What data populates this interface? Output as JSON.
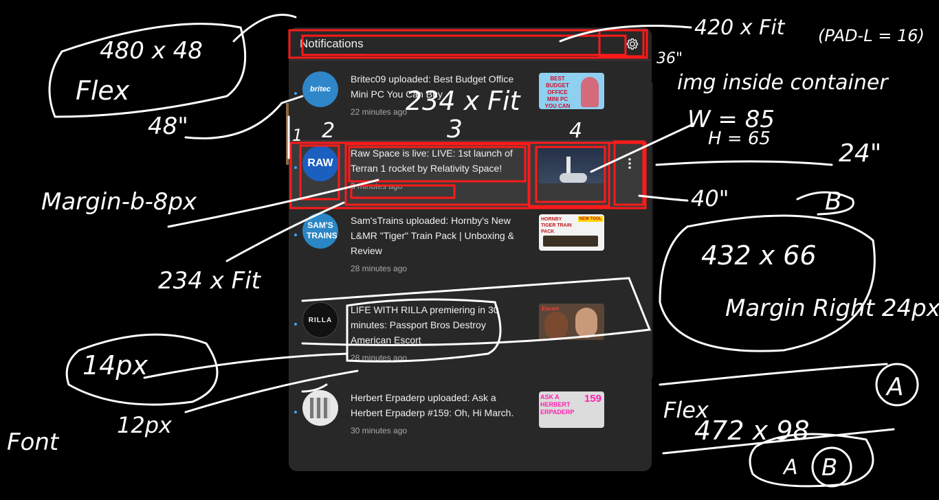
{
  "header": {
    "title": "Notifications",
    "settings_icon": "gear-icon"
  },
  "notifications": [
    {
      "channel": "Britec09",
      "avatar_text": "britec",
      "title": "Britec09 uploaded: Best Budget Office Mini PC You Can Buy",
      "time": "22 minutes ago",
      "thumb_text": "BEST BUDGET OFFICE MINI PC YOU CAN BUY",
      "unread": true
    },
    {
      "channel": "Raw Space",
      "avatar_text": "RAW",
      "title": "Raw Space is live: LIVE: 1st launch of Terran 1 rocket by Relativity Space!",
      "time": "3 minutes ago",
      "thumb_text": "",
      "unread": true
    },
    {
      "channel": "Sam'sTrains",
      "avatar_text": "SAM'S TRAINS",
      "title": "Sam'sTrains uploaded: Hornby's New L&MR \"Tiger\" Train Pack | Unboxing & Review",
      "time": "28 minutes ago",
      "thumb_text": "HORNBY TIGER TRAIN PACK",
      "thumb_badge": "NEW TOOL",
      "unread": true
    },
    {
      "channel": "LIFE WITH RILLA",
      "avatar_text": "RILLA",
      "title": "LIFE WITH RILLA premiering in 30 minutes: Passport Bros Destroy American Escort",
      "time": "28 minutes ago",
      "thumb_text": "Escort",
      "unread": true
    },
    {
      "channel": "Herbert Erpaderp",
      "avatar_text": "",
      "title": "Herbert Erpaderp uploaded: Ask a Herbert Erpaderp #159: Oh, Hi March.",
      "time": "30 minutes ago",
      "thumb_text": "ASK A HERBERT ERPADERP",
      "thumb_num": "159",
      "unread": true
    }
  ],
  "annotations": {
    "a1": "480 x 48",
    "a2": "Flex",
    "a3": "48\"",
    "a4": "420 x Fit",
    "a5": "(PAD-L = 16)",
    "a6": "36\"",
    "a7": "img inside container",
    "a8": "W = 85",
    "a9": "H = 65",
    "a10": "234 x Fit",
    "a11": "1",
    "a12": "2",
    "a13": "3",
    "a14": "4",
    "a15": "24\"",
    "a16": "40\"",
    "a17": "Margin-b-8px",
    "a18": "234 x Fit",
    "a19": "B",
    "a20": "432 x 66",
    "a21": "Margin Right 24px",
    "a22": "14px",
    "a23": "Font",
    "a24": "12px",
    "a25": "Flex",
    "a26": "472 x 98",
    "a27": "A",
    "a28": "A",
    "a29": "B"
  }
}
